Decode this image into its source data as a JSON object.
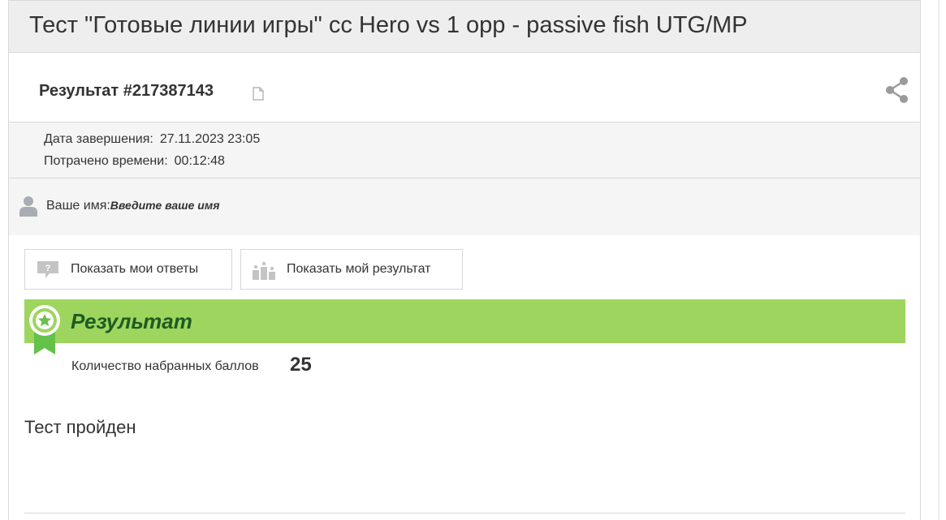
{
  "header": {
    "title": "Тест \"Готовые линии игры\" cc Hero vs 1 opp - passive fish UTG/MP"
  },
  "result": {
    "id_label": "Результат #217387143",
    "copy_icon": "copy-icon",
    "share_icon": "share-icon"
  },
  "meta": {
    "finished_label": "Дата завершения:",
    "finished_value": "27.11.2023 23:05",
    "time_label": "Потрачено времени:",
    "time_value": "00:12:48"
  },
  "user": {
    "name_label": "Ваше имя:",
    "name_placeholder": "Введите ваше имя",
    "icon": "user-icon"
  },
  "buttons": {
    "show_answers": "Показать мои ответы",
    "show_result": "Показать мой результат"
  },
  "result_block": {
    "title": "Результат",
    "score_label": "Количество набранных баллов",
    "score_value": "25",
    "status": "Тест пройден",
    "accent_color": "#9ed55f",
    "title_color": "#1d5b22"
  }
}
